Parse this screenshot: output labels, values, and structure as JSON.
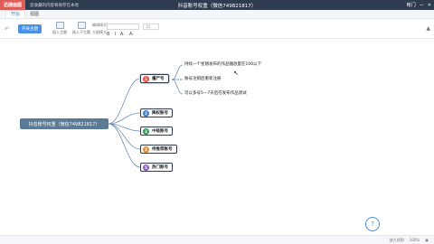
{
  "titlebar": {
    "app_name": "迅捷画图",
    "tip": "您收藏的内容将保存在本地",
    "doc_title": "抖音账号权重（微信749821817）",
    "user": "帐门"
  },
  "menubar": {
    "tabs": [
      "开始",
      "视图"
    ]
  },
  "toolbar": {
    "theme_button": "开关主题",
    "tools": [
      "插入主题",
      "插入子主题"
    ],
    "small_tools": [
      "编辑模式",
      "大纲模式"
    ],
    "font_placeholder": "",
    "font_size": "10",
    "format_buttons": [
      "B",
      "I",
      "A·",
      "A·"
    ]
  },
  "mindmap": {
    "root": "抖音账号权重（微信749821817）",
    "children": [
      {
        "num": "1",
        "label": "僵尸号",
        "color": "#e25747"
      },
      {
        "num": "2",
        "label": "降权账号",
        "color": "#3a7bd5"
      },
      {
        "num": "3",
        "label": "中级账号",
        "color": "#2e9d5b"
      },
      {
        "num": "4",
        "label": "待推荐账号",
        "color": "#e08a2e"
      },
      {
        "num": "5",
        "label": "热门账号",
        "color": "#8e5cc4"
      }
    ],
    "leaves": [
      "持续一个星期发布的作品播放量在100以下",
      "账号注销后重新注册",
      "可以多号5—7天后在发布作品测试"
    ]
  },
  "statusbar": {
    "left": "",
    "right_items": [
      "放大视图",
      "100%",
      "▣"
    ]
  }
}
